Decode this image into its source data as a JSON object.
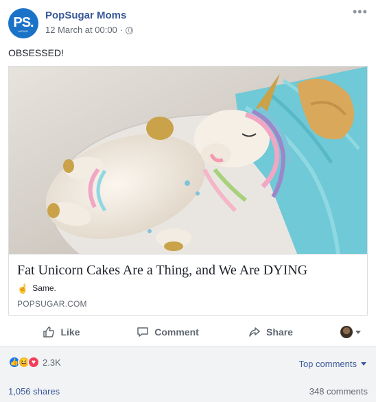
{
  "post": {
    "page_name": "PopSugar Moms",
    "timestamp": "12 March at 00:00",
    "separator": "·",
    "avatar_text": "PS.",
    "avatar_subtext": "MOMS",
    "text": "OBSESSED!",
    "more_icon": "more-dots-icon",
    "privacy_icon": "globe-icon"
  },
  "link_card": {
    "title": "Fat Unicorn Cakes Are a Thing, and We Are DYING",
    "description": "Same.",
    "description_icon": "pointing-hand-icon",
    "domain": "POPSUGAR.COM"
  },
  "actions": {
    "like_label": "Like",
    "comment_label": "Comment",
    "share_label": "Share"
  },
  "stats": {
    "reaction_count": "2.3K",
    "reaction_types": [
      "like",
      "haha",
      "love"
    ],
    "sort_label": "Top comments",
    "shares": "1,056 shares",
    "comments": "348 comments"
  },
  "colors": {
    "link_blue": "#385898",
    "brand_blue": "#1b73c8",
    "muted_grey": "#606770",
    "cake_teal": "#6fc9d6"
  }
}
